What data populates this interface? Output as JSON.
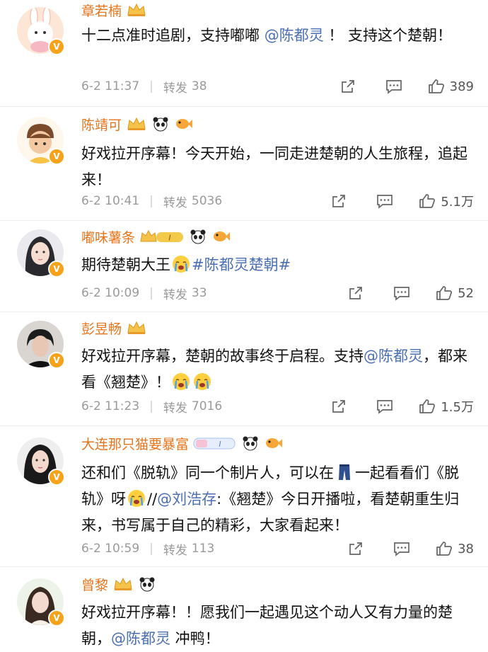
{
  "comments": [
    {
      "username": "章若楠",
      "text_parts": [
        {
          "t": "十二点准时追剧，支持嘟嘟 ",
          "c": "plain"
        },
        {
          "t": "@陈都灵",
          "c": "mention"
        },
        {
          "t": " ！ 支持这个楚朝！",
          "c": "plain"
        }
      ],
      "date": "6-2 11:37",
      "repost_label": "转发",
      "repost_count": "38",
      "likes": "389"
    },
    {
      "username": "陈靖可",
      "text_parts": [
        {
          "t": "好戏拉开序幕！今天开始，一同走进楚朝的人生旅程，追起来！",
          "c": "plain"
        }
      ],
      "date": "6-2 10:41",
      "repost_label": "转发",
      "repost_count": "5036",
      "likes": "5.1万"
    },
    {
      "username": "嘟味薯条",
      "text_parts": [
        {
          "t": "期待楚朝大王",
          "c": "plain"
        },
        {
          "t": "#陈都灵楚朝#",
          "c": "tag"
        }
      ],
      "date": "6-2 10:09",
      "repost_label": "转发",
      "repost_count": "33",
      "likes": "52"
    },
    {
      "username": "彭昱畅",
      "text_parts": [
        {
          "t": "好戏拉开序幕，楚朝的故事终于启程。支持",
          "c": "plain"
        },
        {
          "t": "@陈都灵",
          "c": "mention"
        },
        {
          "t": "，都来看《翘楚》！",
          "c": "plain"
        }
      ],
      "date": "6-2 11:23",
      "repost_label": "转发",
      "repost_count": "7016",
      "likes": "1.5万"
    },
    {
      "username": "大连那只猫要暴富",
      "text_parts": [
        {
          "t": "还和们《脱轨》同一个制片人，可以在",
          "c": "plain"
        },
        {
          "t": "一起看看们《脱轨》呀",
          "c": "plain"
        },
        {
          "t": "//",
          "c": "plain"
        },
        {
          "t": "@刘浩存",
          "c": "mention"
        },
        {
          "t": ":《翘楚》今日开播啦，看楚朝重生归来，书写属于自己的精彩，大家看起来！",
          "c": "plain"
        }
      ],
      "date": "6-2 10:59",
      "repost_label": "转发",
      "repost_count": "113",
      "likes": "38"
    },
    {
      "username": "曾黎",
      "text_parts": [
        {
          "t": "好戏拉开序幕！！愿我们一起遇见这个动人又有力量的楚朝，",
          "c": "plain"
        },
        {
          "t": "@陈都灵",
          "c": "mention"
        },
        {
          "t": " 冲鸭！",
          "c": "plain"
        }
      ]
    }
  ],
  "colors": {
    "username": "#e8741b",
    "mention": "#4a6fb3",
    "meta": "#9a9a9a",
    "verified": "#f7a21b"
  },
  "badge_level_text": "I",
  "icons": {
    "share": "share-icon",
    "comment": "comment-icon",
    "like": "thumbs-up-icon"
  }
}
